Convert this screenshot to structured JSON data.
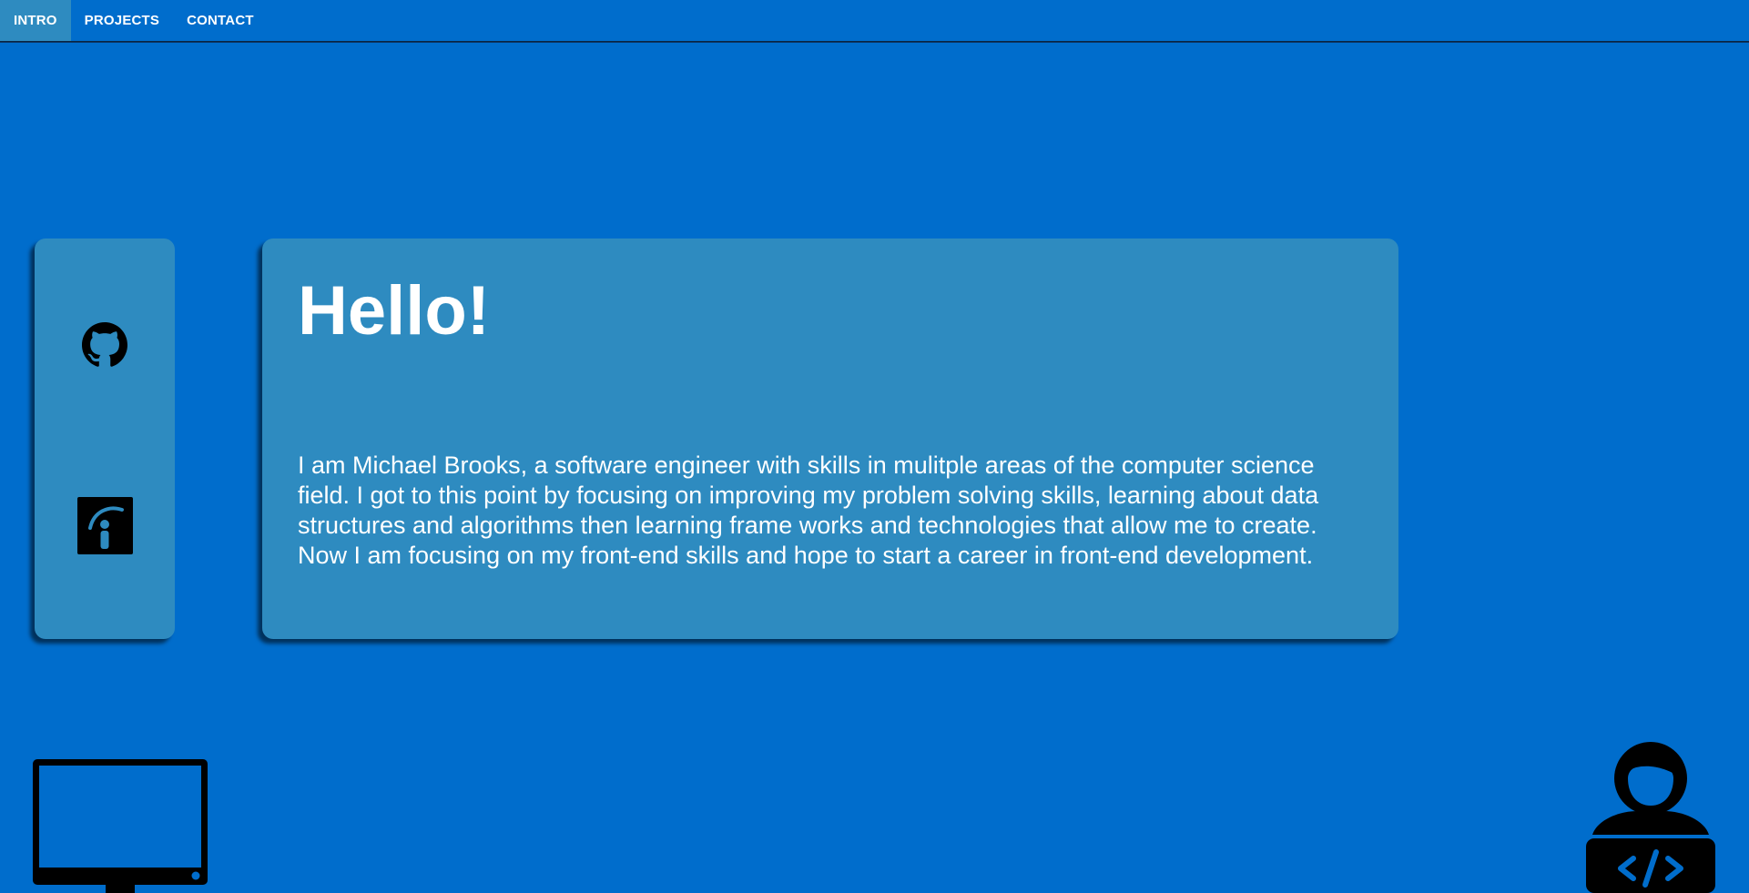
{
  "nav": {
    "items": [
      {
        "label": "INTRO",
        "active": true
      },
      {
        "label": "PROJECTS",
        "active": false
      },
      {
        "label": "CONTACT",
        "active": false
      }
    ]
  },
  "social": {
    "icons": [
      "github-icon",
      "indeed-icon"
    ]
  },
  "intro": {
    "heading": "Hello!",
    "bio": "I am Michael Brooks, a software engineer with skills in mulitple areas of the computer science field. I got to this point by focusing on improving my problem solving skills, learning about data structures and algorithms then learning frame works and technologies that allow me to create. Now I am focusing on my front-end skills and hope to start a career in front-end development."
  },
  "decor": {
    "icons": [
      "monitor-icon",
      "developer-icon"
    ]
  },
  "colors": {
    "background": "#006dcc",
    "card": "#2e8bc0",
    "active_tab": "#2e8bc0",
    "text": "#ffffff",
    "icon": "#000000"
  }
}
